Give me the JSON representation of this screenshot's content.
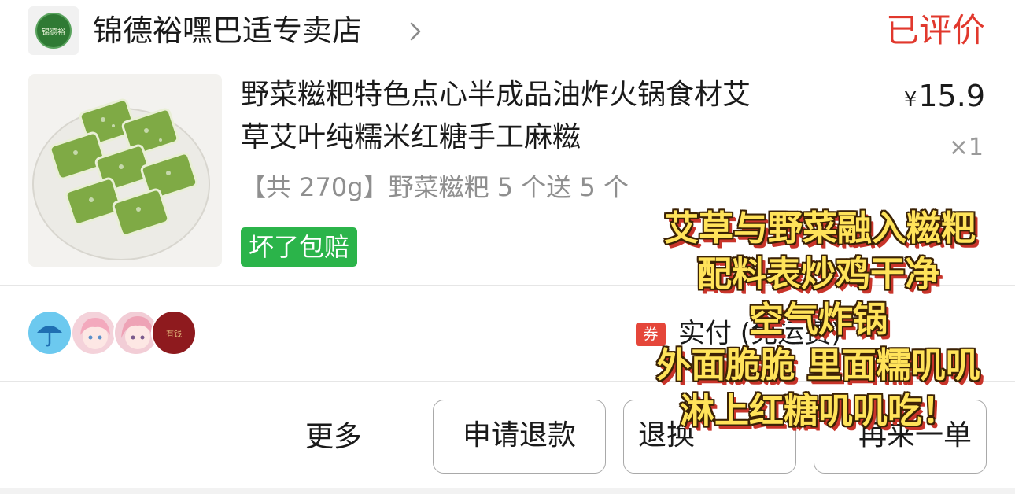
{
  "store": {
    "name": "锦德裕嘿巴适专卖店",
    "status": "已评价"
  },
  "product": {
    "title_line1": "野菜糍粑特色点心半成品油炸火锅食材艾",
    "title_line2": "草艾叶纯糯米红糖手工麻糍",
    "price_symbol": "¥",
    "price": "15.9",
    "quantity": "×1",
    "spec": "【共 270g】野菜糍粑 5 个送 5 个",
    "guarantee_tag": "坏了包赔"
  },
  "payment": {
    "coupon_badge": "券",
    "text": "实付 (免运费)"
  },
  "actions": {
    "more": "更多",
    "refund": "申请退款",
    "return": "退换",
    "reorder": "再来一单"
  },
  "overlay_caption": {
    "line1": "艾草与野菜融入糍粑",
    "line2": "配料表炒鸡干净",
    "line3": "空气炸锅",
    "line4": "外面脆脆 里面糯叽叽",
    "line5": "淋上红糖叽叽吃！"
  },
  "colors": {
    "status_red": "#e1382d",
    "tag_green": "#2bb44a",
    "coupon_red": "#e5463a",
    "caption_yellow": "#ffe35a"
  },
  "icons": {
    "store_logo": "store-logo",
    "chevron": "chevron-right-icon",
    "umbrella_avatar": "umbrella-icon"
  }
}
